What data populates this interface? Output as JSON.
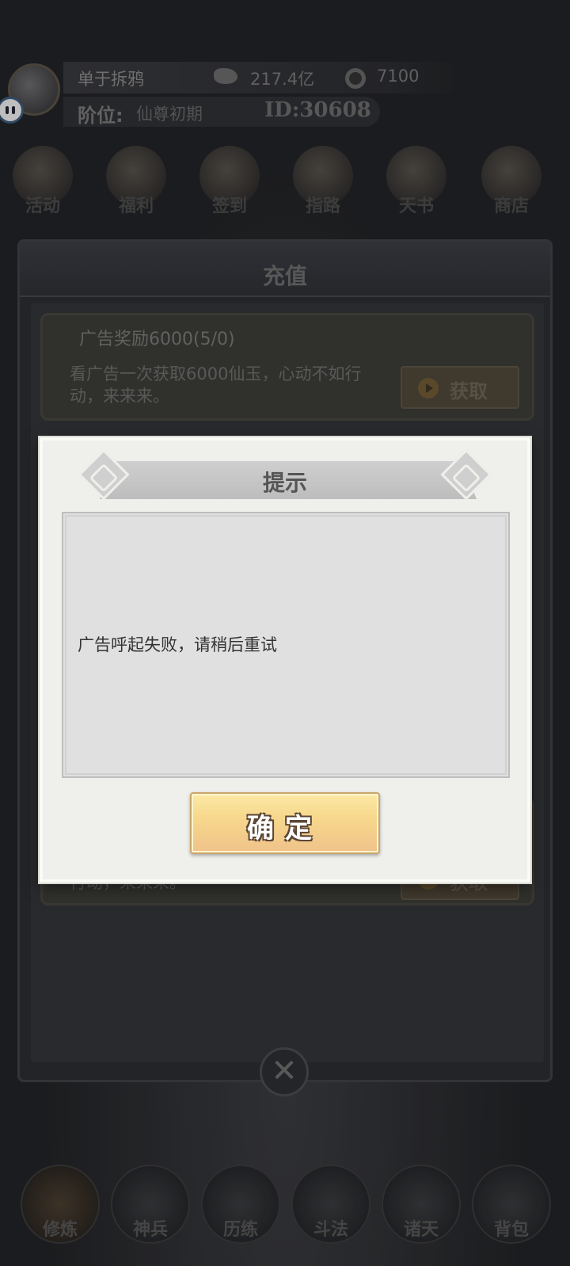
{
  "header": {
    "player_name": "单于拆鸦",
    "spirit_stone": "217.4亿",
    "coins": "7100",
    "rank_label": "阶位:",
    "rank_value": "仙尊初期",
    "player_id": "ID:30608"
  },
  "shortcuts": [
    {
      "label": "活动",
      "icon": "activity-icon"
    },
    {
      "label": "福利",
      "icon": "welfare-icon"
    },
    {
      "label": "签到",
      "icon": "checkin-icon"
    },
    {
      "label": "指路",
      "icon": "guide-icon"
    },
    {
      "label": "天书",
      "icon": "heaven-book-icon"
    },
    {
      "label": "商店",
      "icon": "shop-icon"
    }
  ],
  "recharge_panel": {
    "title": "充值",
    "cards": [
      {
        "title": "广告奖励6000(5/0)",
        "description": "看广告一次获取6000仙玉，心动不如行动，来来来。",
        "button": "获取"
      },
      {
        "description": "行动，来来来。",
        "button": "获取"
      }
    ],
    "close_icon": "close-icon"
  },
  "bottom_nav": [
    {
      "label": "修炼",
      "icon": "cultivate-icon"
    },
    {
      "label": "神兵",
      "icon": "weapon-icon"
    },
    {
      "label": "历练",
      "icon": "training-icon"
    },
    {
      "label": "斗法",
      "icon": "duel-icon"
    },
    {
      "label": "诸天",
      "icon": "heavens-icon"
    },
    {
      "label": "背包",
      "icon": "bag-icon"
    }
  ],
  "dialog": {
    "title": "提示",
    "message": "广告呼起失败，请稍后重试",
    "confirm_label": "确定"
  }
}
